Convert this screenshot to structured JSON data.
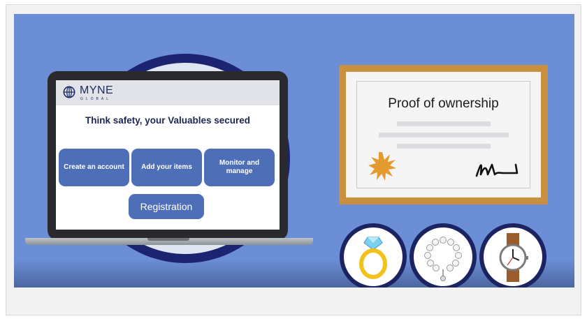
{
  "brand": {
    "name": "MYNE",
    "subtitle": "GLOBAL",
    "logo_icon": "globe-icon"
  },
  "headline": "Think safety, your Valuables secured",
  "steps": [
    {
      "label": "Create an account"
    },
    {
      "label": "Add your items"
    },
    {
      "label": "Monitor and manage"
    }
  ],
  "registration_button": "Registration",
  "certificate": {
    "title": "Proof of ownership",
    "seal_icon": "seal-icon",
    "signature_icon": "signature-icon"
  },
  "valuables": [
    {
      "icon": "ring-icon"
    },
    {
      "icon": "pearl-bracelet-icon"
    },
    {
      "icon": "wristwatch-icon"
    }
  ],
  "colors": {
    "background": "#6b8ed6",
    "accent_navy": "#1c2370",
    "button_blue": "#4f6eb8",
    "frame_gold": "#c8903f",
    "seal_orange": "#e39a2e"
  }
}
